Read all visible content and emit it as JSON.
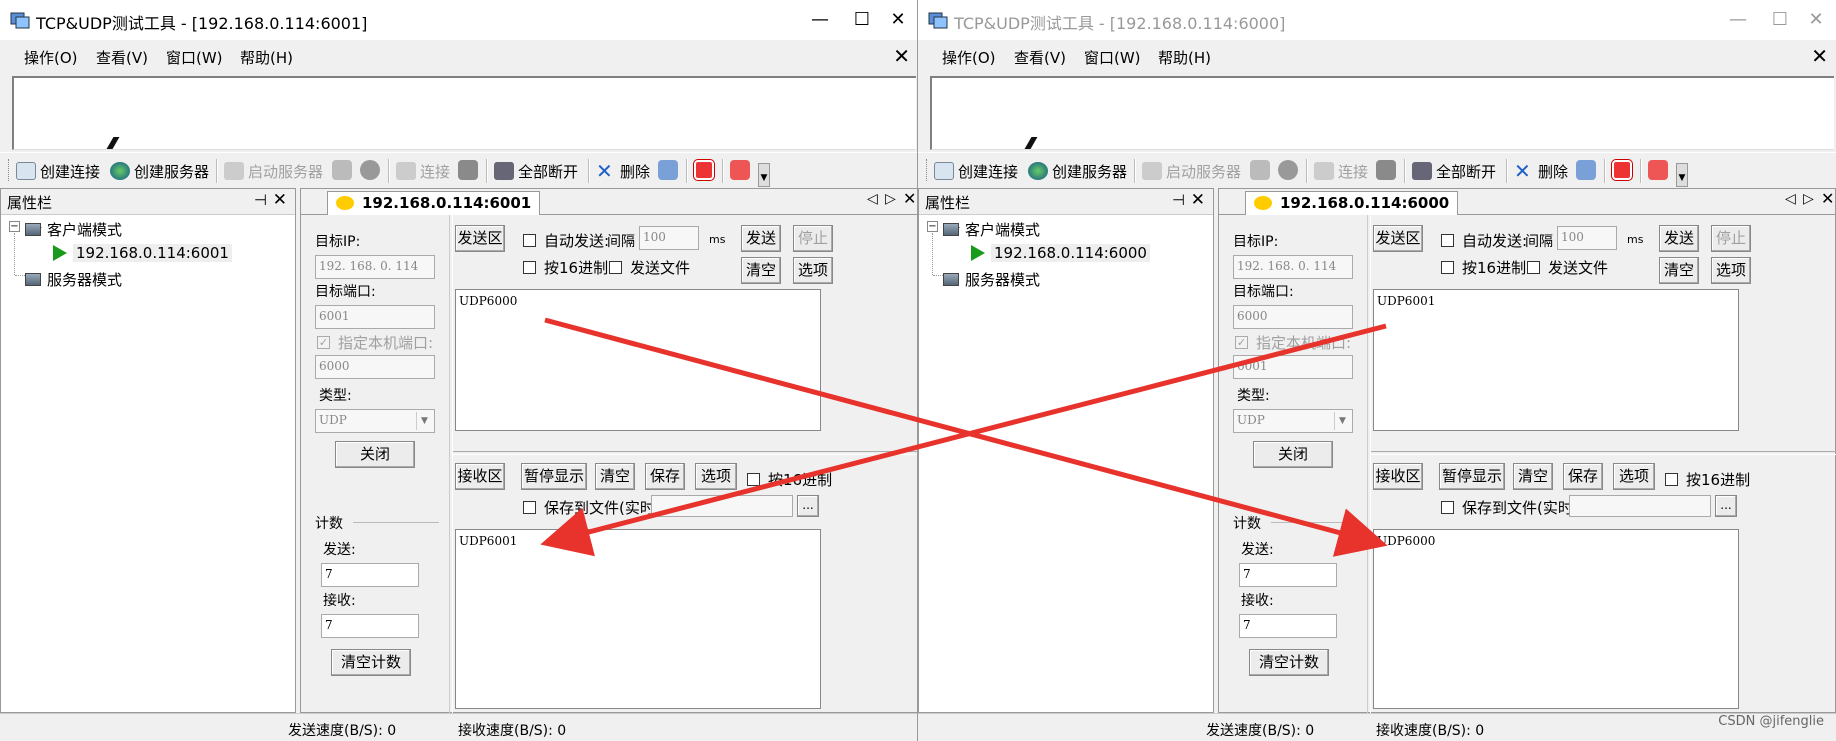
{
  "windows": [
    {
      "title": "TCP&UDP测试工具 - [192.168.0.114:6001]",
      "menus": [
        "操作(O)",
        "查看(V)",
        "窗口(W)",
        "帮助(H)"
      ],
      "toolbar": [
        "创建连接",
        "创建服务器",
        "启动服务器",
        "连接",
        "全部断开",
        "删除"
      ],
      "props_title": "属性栏",
      "tree": {
        "client_mode": "客户端模式",
        "connection": "192.168.0.114:6001",
        "server_mode": "服务器模式"
      },
      "tab": "192.168.0.114:6001",
      "target_ip_label": "目标IP:",
      "target_ip": "192. 168. 0. 114",
      "target_port_label": "目标端口:",
      "target_port": "6001",
      "local_port_label": "指定本机端口:",
      "local_port": "6000",
      "type_label": "类型:",
      "type": "UDP",
      "close_btn": "关闭",
      "count_label": "计数",
      "send_label": "发送:",
      "send_count": "7",
      "recv_label": "接收:",
      "recv_count": "7",
      "clear_count": "清空计数",
      "send_area": "发送区",
      "auto_send": "自动发送:",
      "interval": "间隔",
      "interval_value": "100",
      "ms": "ms",
      "send_btn": "发送",
      "stop_btn": "停止",
      "hex_send": "按16进制",
      "send_file": "发送文件",
      "clear_send": "清空",
      "options_send": "选项",
      "send_text": "UDP6000",
      "recv_area": "接收区",
      "pause_display": "暂停显示",
      "clear_recv": "清空",
      "save": "保存",
      "options_recv": "选项",
      "hex_recv": "按16进制",
      "save_file": "保存到文件(实时)",
      "browse": "...",
      "recv_text": "UDP6001",
      "send_speed": "发送速度(B/S): 0",
      "recv_speed": "接收速度(B/S): 0"
    },
    {
      "title": "TCP&UDP测试工具 - [192.168.0.114:6000]",
      "menus": [
        "操作(O)",
        "查看(V)",
        "窗口(W)",
        "帮助(H)"
      ],
      "toolbar": [
        "创建连接",
        "创建服务器",
        "启动服务器",
        "连接",
        "全部断开",
        "删除"
      ],
      "props_title": "属性栏",
      "tree": {
        "client_mode": "客户端模式",
        "connection": "192.168.0.114:6000",
        "server_mode": "服务器模式"
      },
      "tab": "192.168.0.114:6000",
      "target_ip_label": "目标IP:",
      "target_ip": "192. 168. 0. 114",
      "target_port_label": "目标端口:",
      "target_port": "6000",
      "local_port_label": "指定本机端口:",
      "local_port": "6001",
      "type_label": "类型:",
      "type": "UDP",
      "close_btn": "关闭",
      "count_label": "计数",
      "send_label": "发送:",
      "send_count": "7",
      "recv_label": "接收:",
      "recv_count": "7",
      "clear_count": "清空计数",
      "send_area": "发送区",
      "auto_send": "自动发送:",
      "interval": "间隔",
      "interval_value": "100",
      "ms": "ms",
      "send_btn": "发送",
      "stop_btn": "停止",
      "hex_send": "按16进制",
      "send_file": "发送文件",
      "clear_send": "清空",
      "options_send": "选项",
      "send_text": "UDP6001",
      "recv_area": "接收区",
      "pause_display": "暂停显示",
      "clear_recv": "清空",
      "save": "保存",
      "options_recv": "选项",
      "hex_recv": "按16进制",
      "save_file": "保存到文件(实时)",
      "browse": "...",
      "recv_text": "UDP6000",
      "send_speed": "发送速度(B/S): 0",
      "recv_speed": "接收速度(B/S): 0"
    }
  ],
  "window_controls": {
    "minimize": "—",
    "maximize": "☐",
    "close": "✕"
  },
  "watermark": "CSDN @jifenglie",
  "colors": {
    "arrow": "#e8322c",
    "play": "#1a9a1a"
  }
}
